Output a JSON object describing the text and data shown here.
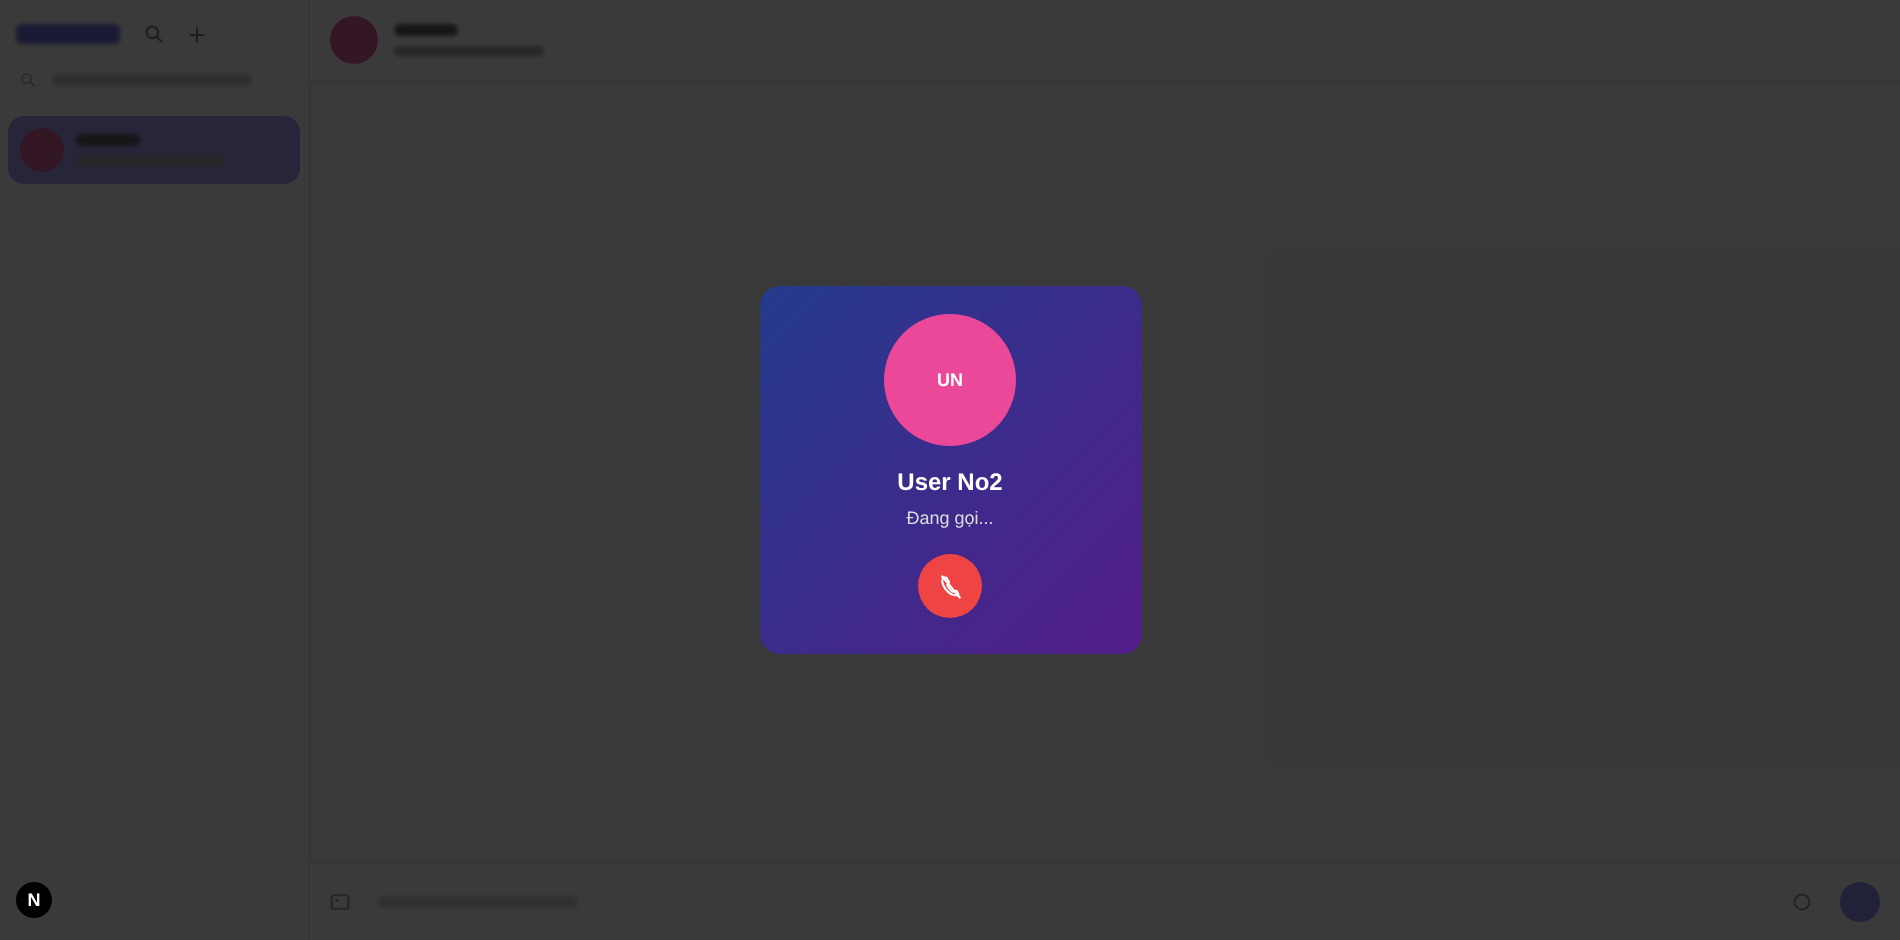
{
  "sidebar": {
    "conversations": [
      {
        "selected": true
      }
    ]
  },
  "call_dialog": {
    "initials": "UN",
    "name": "User No2",
    "status": "Đang gọi..."
  },
  "dev_badge": "N"
}
